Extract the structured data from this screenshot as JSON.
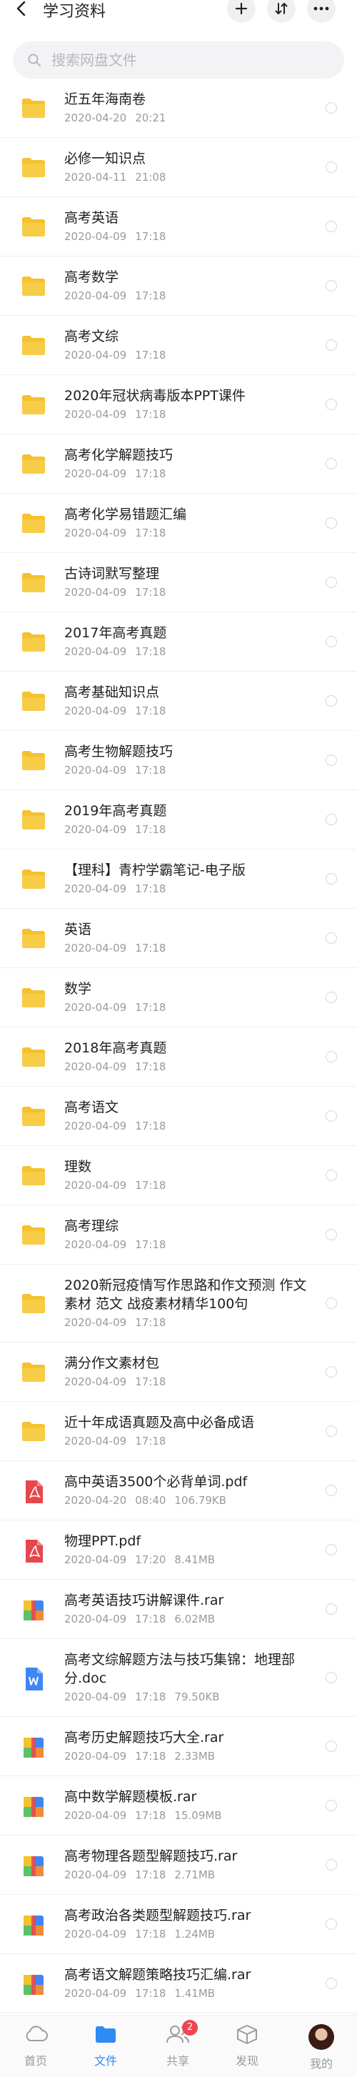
{
  "header": {
    "title": "学习资料"
  },
  "search": {
    "placeholder": "搜索网盘文件"
  },
  "files": [
    {
      "name": "近五年海南卷",
      "date": "2020-04-20",
      "time": "20:21",
      "size": "",
      "type": "folder"
    },
    {
      "name": "必修一知识点",
      "date": "2020-04-11",
      "time": "21:08",
      "size": "",
      "type": "folder"
    },
    {
      "name": "高考英语",
      "date": "2020-04-09",
      "time": "17:18",
      "size": "",
      "type": "folder"
    },
    {
      "name": "高考数学",
      "date": "2020-04-09",
      "time": "17:18",
      "size": "",
      "type": "folder"
    },
    {
      "name": "高考文综",
      "date": "2020-04-09",
      "time": "17:18",
      "size": "",
      "type": "folder"
    },
    {
      "name": "2020年冠状病毒版本PPT课件",
      "date": "2020-04-09",
      "time": "17:18",
      "size": "",
      "type": "folder"
    },
    {
      "name": "高考化学解题技巧",
      "date": "2020-04-09",
      "time": "17:18",
      "size": "",
      "type": "folder"
    },
    {
      "name": "高考化学易错题汇编",
      "date": "2020-04-09",
      "time": "17:18",
      "size": "",
      "type": "folder"
    },
    {
      "name": "古诗词默写整理",
      "date": "2020-04-09",
      "time": "17:18",
      "size": "",
      "type": "folder"
    },
    {
      "name": "2017年高考真题",
      "date": "2020-04-09",
      "time": "17:18",
      "size": "",
      "type": "folder"
    },
    {
      "name": "高考基础知识点",
      "date": "2020-04-09",
      "time": "17:18",
      "size": "",
      "type": "folder"
    },
    {
      "name": "高考生物解题技巧",
      "date": "2020-04-09",
      "time": "17:18",
      "size": "",
      "type": "folder"
    },
    {
      "name": "2019年高考真题",
      "date": "2020-04-09",
      "time": "17:18",
      "size": "",
      "type": "folder"
    },
    {
      "name": "【理科】青柠学霸笔记-电子版",
      "date": "2020-04-09",
      "time": "17:18",
      "size": "",
      "type": "folder"
    },
    {
      "name": "英语",
      "date": "2020-04-09",
      "time": "17:18",
      "size": "",
      "type": "folder"
    },
    {
      "name": "数学",
      "date": "2020-04-09",
      "time": "17:18",
      "size": "",
      "type": "folder"
    },
    {
      "name": "2018年高考真题",
      "date": "2020-04-09",
      "time": "17:18",
      "size": "",
      "type": "folder"
    },
    {
      "name": "高考语文",
      "date": "2020-04-09",
      "time": "17:18",
      "size": "",
      "type": "folder"
    },
    {
      "name": "理数",
      "date": "2020-04-09",
      "time": "17:18",
      "size": "",
      "type": "folder"
    },
    {
      "name": "高考理综",
      "date": "2020-04-09",
      "time": "17:18",
      "size": "",
      "type": "folder"
    },
    {
      "name": "2020新冠疫情写作思路和作文预测 作文素材 范文 战疫素材精华100句",
      "date": "2020-04-09",
      "time": "17:18",
      "size": "",
      "type": "folder"
    },
    {
      "name": "满分作文素材包",
      "date": "2020-04-09",
      "time": "17:18",
      "size": "",
      "type": "folder"
    },
    {
      "name": "近十年成语真题及高中必备成语",
      "date": "2020-04-09",
      "time": "17:18",
      "size": "",
      "type": "folder"
    },
    {
      "name": "高中英语3500个必背单词.pdf",
      "date": "2020-04-20",
      "time": "08:40",
      "size": "106.79KB",
      "type": "pdf"
    },
    {
      "name": "物理PPT.pdf",
      "date": "2020-04-09",
      "time": "17:20",
      "size": "8.41MB",
      "type": "pdf"
    },
    {
      "name": "高考英语技巧讲解课件.rar",
      "date": "2020-04-09",
      "time": "17:18",
      "size": "6.02MB",
      "type": "rar"
    },
    {
      "name": "高考文综解题方法与技巧集锦：地理部分.doc",
      "date": "2020-04-09",
      "time": "17:18",
      "size": "79.50KB",
      "type": "doc"
    },
    {
      "name": "高考历史解题技巧大全.rar",
      "date": "2020-04-09",
      "time": "17:18",
      "size": "2.33MB",
      "type": "rar"
    },
    {
      "name": "高中数学解题模板.rar",
      "date": "2020-04-09",
      "time": "17:18",
      "size": "15.09MB",
      "type": "rar"
    },
    {
      "name": "高考物理各题型解题技巧.rar",
      "date": "2020-04-09",
      "time": "17:18",
      "size": "2.71MB",
      "type": "rar"
    },
    {
      "name": "高考政治各类题型解题技巧.rar",
      "date": "2020-04-09",
      "time": "17:18",
      "size": "1.24MB",
      "type": "rar"
    },
    {
      "name": "高考语文解题策略技巧汇编.rar",
      "date": "2020-04-09",
      "time": "17:18",
      "size": "1.41MB",
      "type": "rar"
    }
  ],
  "tabbar": {
    "home": "首页",
    "files": "文件",
    "share": "共享",
    "share_badge": "2",
    "discover": "发现",
    "mine": "我的"
  },
  "colors": {
    "accent": "#2e8bf6",
    "folder": "#f5c12e",
    "pdf": "#e6474d",
    "doc": "#3f86f4",
    "badge": "#f0464f"
  }
}
